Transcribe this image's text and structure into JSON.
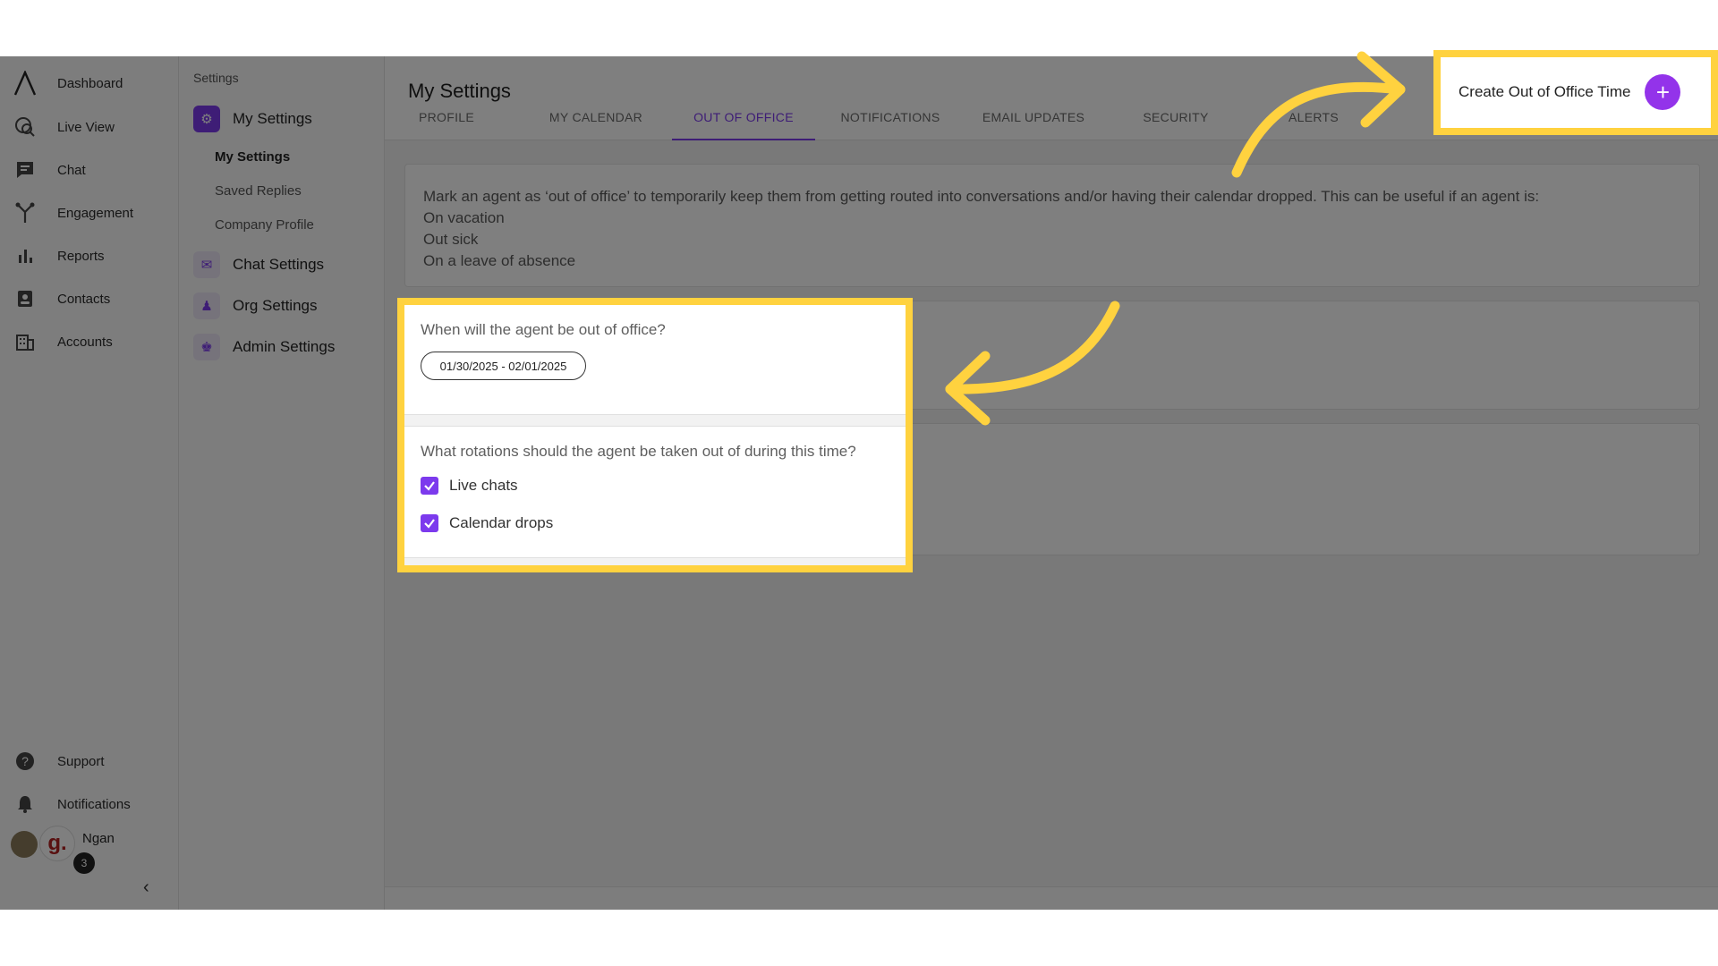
{
  "nav": {
    "items": [
      {
        "label": "Dashboard",
        "icon": "logo-icon"
      },
      {
        "label": "Live View",
        "icon": "live-view-icon"
      },
      {
        "label": "Chat",
        "icon": "chat-icon"
      },
      {
        "label": "Engagement",
        "icon": "engagement-icon"
      },
      {
        "label": "Reports",
        "icon": "reports-icon"
      },
      {
        "label": "Contacts",
        "icon": "contacts-icon"
      },
      {
        "label": "Accounts",
        "icon": "accounts-icon"
      }
    ],
    "bottom": [
      {
        "label": "Support",
        "icon": "help-icon"
      },
      {
        "label": "Notifications",
        "icon": "bell-icon"
      }
    ],
    "user": {
      "name": "Ngan",
      "badge_count": "3"
    }
  },
  "settings_menu": {
    "heading": "Settings",
    "groups": [
      {
        "label": "My Settings",
        "icon": "gear-icon"
      },
      {
        "label": "Chat Settings",
        "icon": "chat-settings-icon"
      },
      {
        "label": "Org Settings",
        "icon": "org-icon"
      },
      {
        "label": "Admin Settings",
        "icon": "admin-icon"
      }
    ],
    "sub_items": [
      "My Settings",
      "Saved Replies",
      "Company Profile"
    ]
  },
  "page": {
    "title": "My Settings",
    "tabs": [
      "PROFILE",
      "MY CALENDAR",
      "OUT OF OFFICE",
      "NOTIFICATIONS",
      "EMAIL UPDATES",
      "SECURITY",
      "ALERTS"
    ],
    "active_tab": "OUT OF OFFICE",
    "create_button_label": "Create Out of Office Time",
    "description": {
      "intro": "Mark an agent as ‘out of office’ to temporarily keep them from getting routed into conversations and/or having their calendar dropped. This can be useful if an agent is:",
      "lines": [
        "On vacation",
        "Out sick",
        "On a leave of absence"
      ]
    }
  },
  "form": {
    "question1": "When will the agent be out of office?",
    "date_range": "01/30/2025 - 02/01/2025",
    "question2": "What rotations should the agent be taken out of during this time?",
    "options": [
      {
        "label": "Live chats",
        "checked": true
      },
      {
        "label": "Calendar drops",
        "checked": true
      }
    ]
  },
  "colors": {
    "accent": "#7c3aed",
    "highlight": "#ffd23f"
  }
}
